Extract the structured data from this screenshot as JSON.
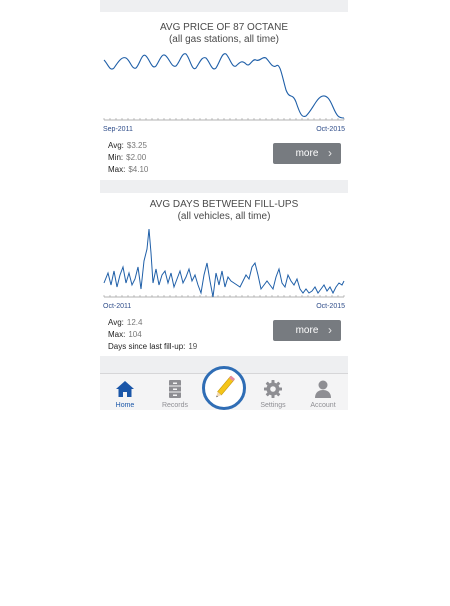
{
  "gas_card": {
    "title": "AVG PRICE OF 87 OCTANE",
    "subtitle": "(all gas stations, all time)",
    "x_start": "Sep-2011",
    "x_end": "Oct-2015",
    "stats": [
      {
        "label": "Avg:",
        "value": "$3.25"
      },
      {
        "label": "Min:",
        "value": "$2.00"
      },
      {
        "label": "Max:",
        "value": "$4.10"
      }
    ],
    "more_label": "more",
    "line_color": "#1f5fa8"
  },
  "days_card": {
    "title": "AVG DAYS BETWEEN FILL-UPS",
    "subtitle": "(all vehicles, all time)",
    "x_start": "Oct-2011",
    "x_end": "Oct-2015",
    "stats": [
      {
        "label": "Avg:",
        "value": "12.4"
      },
      {
        "label": "Max:",
        "value": "104"
      },
      {
        "label": "Days since last fill-up:",
        "value": "19"
      }
    ],
    "more_label": "more",
    "line_color": "#1f5fa8"
  },
  "tabbar": {
    "tabs": [
      {
        "label": "Home",
        "icon": "home-icon",
        "active": true
      },
      {
        "label": "Records",
        "icon": "file-cabinet-icon",
        "active": false
      },
      {
        "label": "Settings",
        "icon": "gear-icon",
        "active": false
      },
      {
        "label": "Account",
        "icon": "person-icon",
        "active": false
      }
    ],
    "fab_icon": "pencil-icon",
    "active_color": "#1a56a8",
    "fab_color": "#2f6db5"
  }
}
